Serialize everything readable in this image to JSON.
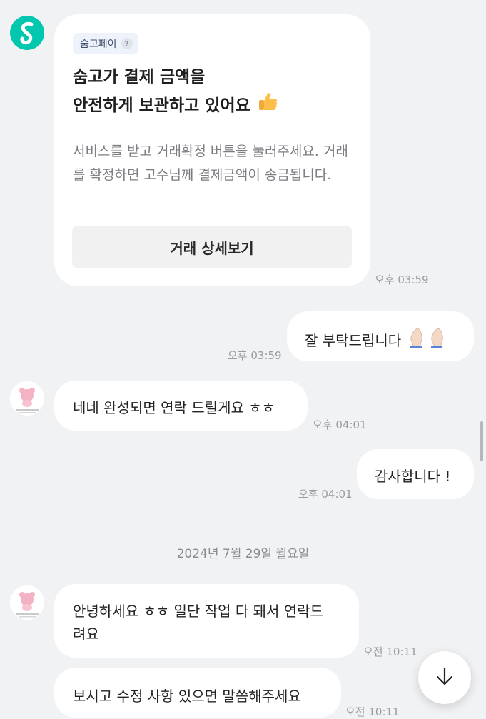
{
  "payment_card": {
    "tag_label": "숨고페이",
    "help_glyph": "?",
    "title_line1": "숨고가 결제 금액을",
    "title_line2": "안전하게 보관하고 있어요",
    "body": "서비스를 받고 거래확정 버튼을 눌러주세요. 거래를 확정하면 고수님께 결제금액이 송금됩니다.",
    "button_label": "거래 상세보기",
    "time": "오후 03:59"
  },
  "messages": [
    {
      "side": "out",
      "text": "잘 부탁드립니다",
      "time": "오후 03:59"
    },
    {
      "side": "in",
      "text": "네네 완성되면 연락 드릴게요 ㅎㅎ",
      "time": "오후 04:01"
    },
    {
      "side": "out",
      "text": "감사합니다 !",
      "time": "오후 04:01"
    },
    {
      "side": "in",
      "text_line1": "안녕하세요 ㅎㅎ 일단 작업 다 돼서 연락드",
      "text_line2": "려요",
      "time": "오전 10:11"
    },
    {
      "side": "in",
      "text": "보시고 수정 사항 있으면 말씀해주세요",
      "time": "오전 10:11"
    }
  ],
  "date_separator": "2024년 7월 29일 월요일",
  "icons": {
    "logo": "soomgo-logo-icon",
    "thumbs": "thumbs-up-icon",
    "pray": "folded-hands-icon",
    "scroll": "arrow-down-icon"
  },
  "colors": {
    "brand": "#00c7ae",
    "background": "#f1f2f4"
  }
}
